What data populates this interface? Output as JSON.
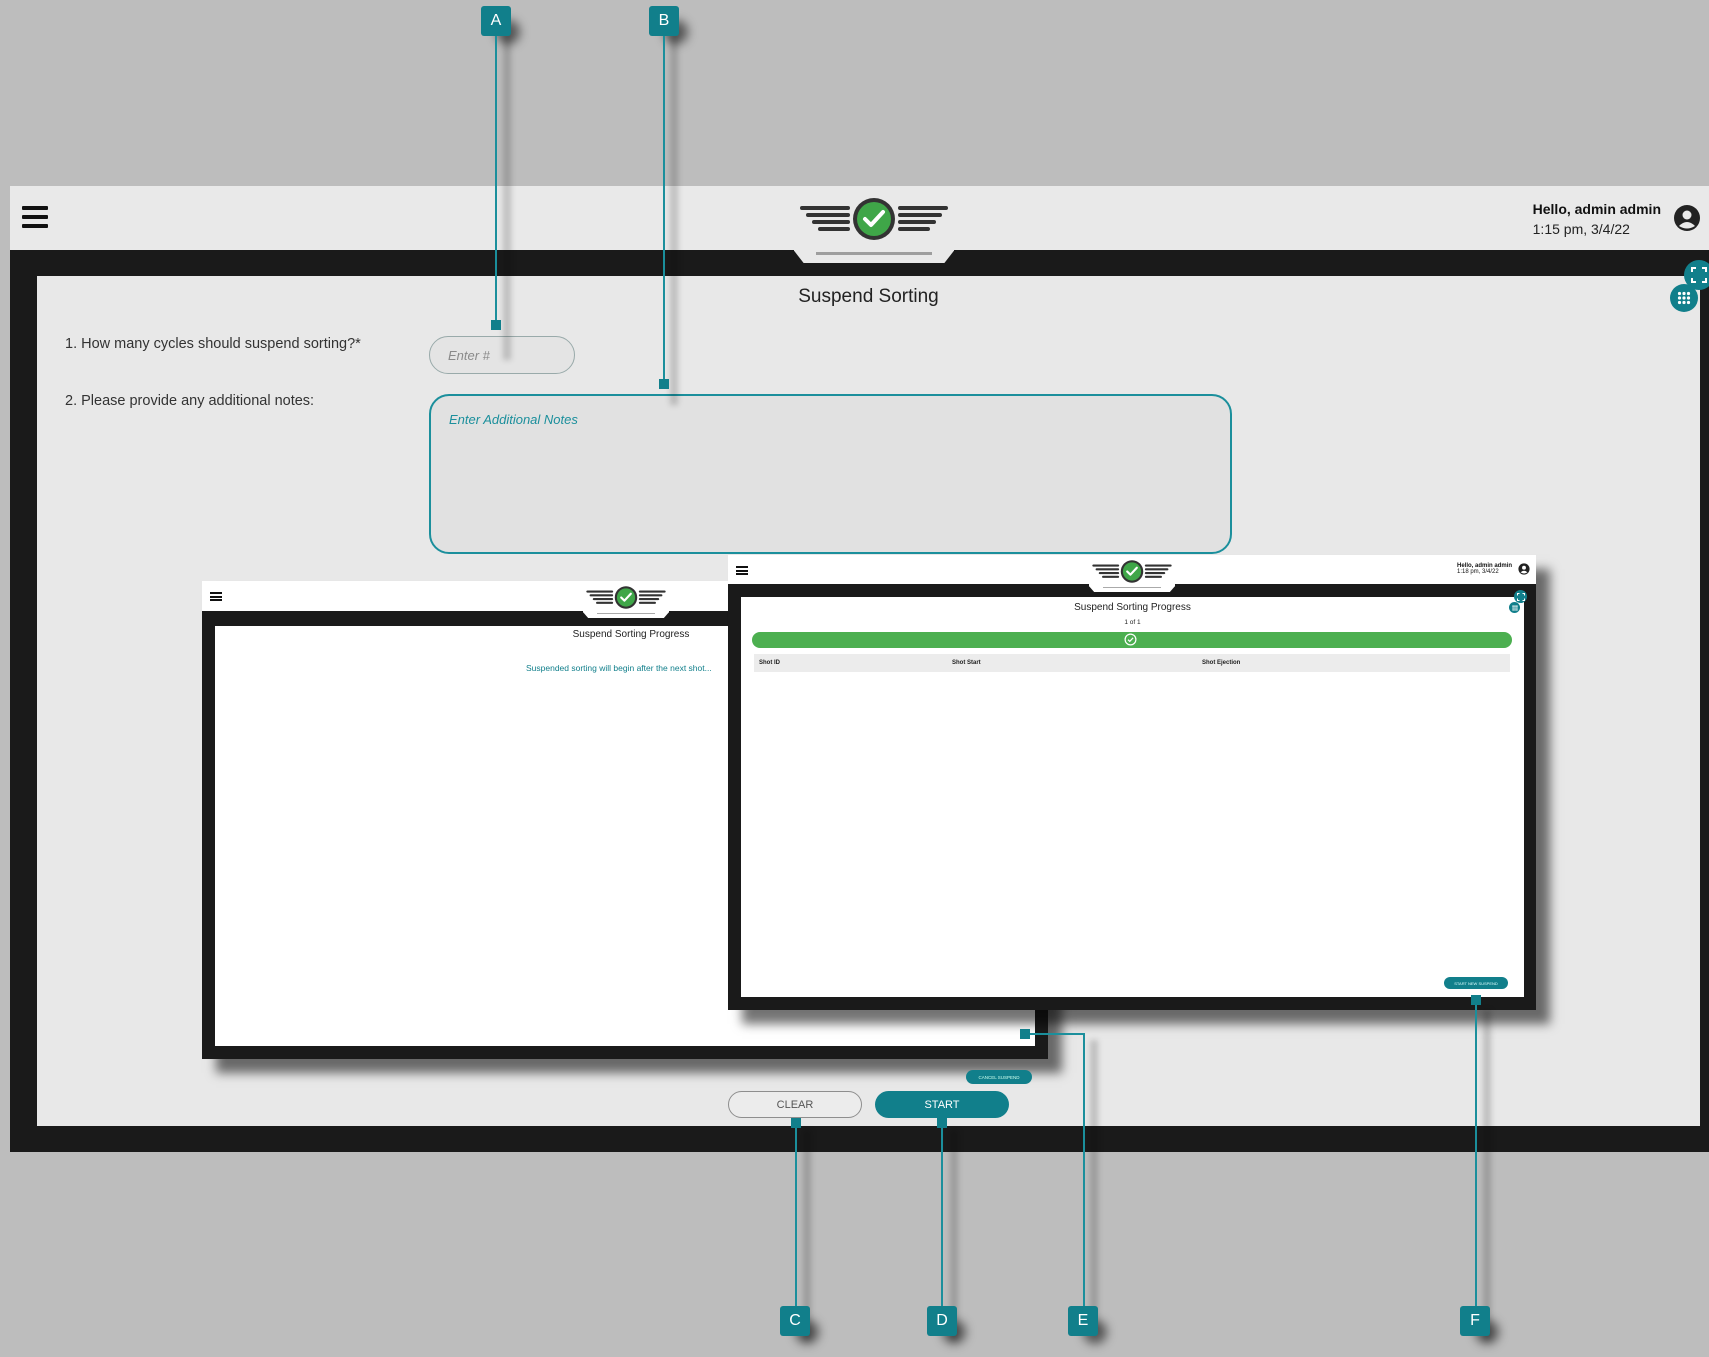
{
  "header": {
    "user_greeting": "Hello, admin admin",
    "datetime": "1:15 pm, 3/4/22"
  },
  "form": {
    "title": "Suspend Sorting",
    "q1_label": "1. How many cycles should suspend sorting?*",
    "q1_placeholder": "Enter #",
    "q2_label": "2. Please provide any additional notes:",
    "q2_placeholder": "Enter Additional Notes",
    "clear_label": "CLEAR",
    "start_label": "START"
  },
  "inset_pending": {
    "title": "Suspend Sorting Progress",
    "message": "Suspended sorting will begin after the next shot...",
    "cancel_label": "CANCEL SUSPEND"
  },
  "inset_progress": {
    "user_greeting": "Hello, admin admin",
    "datetime": "1:18 pm, 3/4/22",
    "title": "Suspend Sorting Progress",
    "counter": "1 of 1",
    "progress_fraction": 1.0,
    "columns": [
      "Shot ID",
      "Shot Start",
      "Shot Ejection"
    ],
    "start_new_label": "START NEW SUSPEND"
  },
  "callouts": [
    "A",
    "B",
    "C",
    "D",
    "E",
    "F"
  ],
  "colors": {
    "accent": "#117f8b",
    "success": "#4caf50",
    "frame": "#1a1a1a",
    "background": "#bdbdbd"
  }
}
